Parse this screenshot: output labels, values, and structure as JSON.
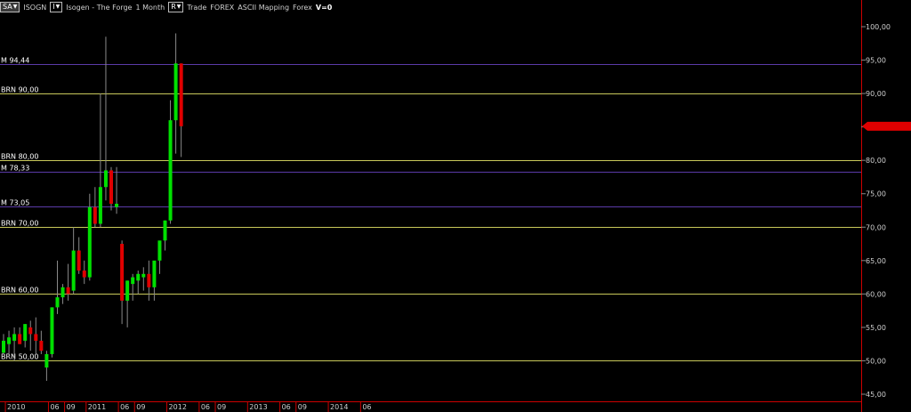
{
  "toolbar": {
    "symbol_box": "SA",
    "symbol": "ISOGN",
    "study_box": "I",
    "title": "Isogen - The Forge",
    "period": "1 Month",
    "r_box": "R",
    "account": "Trade",
    "market": "FOREX",
    "mapping": "ASCII Mapping",
    "market2": "Forex",
    "version": "V=0"
  },
  "colors": {
    "background": "#000000",
    "up_candle": "#00e000",
    "down_candle": "#e00000",
    "brn_line": "#c8c85a",
    "m_line": "#5a3aa8",
    "axis_text": "#cfcfcf",
    "axis_border": "#cc0000",
    "last_price_flag": "#e00000"
  },
  "chart_data": {
    "type": "candlestick",
    "ylim": [
      44,
      102
    ],
    "y_ticks": [
      "45,00",
      "50,00",
      "55,00",
      "60,00",
      "65,00",
      "70,00",
      "75,00",
      "80,00",
      "85,00",
      "90,00",
      "95,00",
      "100,00"
    ],
    "y_tick_values": [
      45,
      50,
      55,
      60,
      65,
      70,
      75,
      80,
      85,
      90,
      95,
      100
    ],
    "x_labels": [
      "2010",
      "06",
      "09",
      "2011",
      "06",
      "09",
      "2012",
      "06",
      "09",
      "2013",
      "06",
      "09",
      "2014",
      "06"
    ],
    "x_label_index": [
      1,
      9,
      12,
      16,
      22,
      25,
      31,
      37,
      40,
      46,
      52,
      55,
      61,
      67
    ],
    "last_price": 85.1,
    "horizontal_levels": [
      {
        "label": "M 94,44",
        "value": 94.44,
        "kind": "m"
      },
      {
        "label": "BRN 90,00",
        "value": 90.0,
        "kind": "brn"
      },
      {
        "label": "BRN 80,00",
        "value": 80.0,
        "kind": "brn"
      },
      {
        "label": "M 78,33",
        "value": 78.33,
        "kind": "m"
      },
      {
        "label": "M 73,05",
        "value": 73.05,
        "kind": "m"
      },
      {
        "label": "BRN 70,00",
        "value": 70.0,
        "kind": "brn"
      },
      {
        "label": "BRN 60,00",
        "value": 60.0,
        "kind": "brn"
      },
      {
        "label": "BRN 50,00",
        "value": 50.0,
        "kind": "brn"
      }
    ],
    "candles": [
      [
        51.2,
        54.0,
        51.0,
        53.0
      ],
      [
        52.5,
        54.5,
        50.5,
        53.5
      ],
      [
        53.0,
        55.0,
        50.0,
        54.0
      ],
      [
        54.0,
        55.0,
        52.5,
        52.5
      ],
      [
        53.0,
        55.5,
        52.0,
        55.5
      ],
      [
        55.0,
        56.0,
        51.5,
        54.0
      ],
      [
        54.0,
        56.5,
        51.0,
        53.0
      ],
      [
        53.0,
        54.5,
        51.0,
        51.5
      ],
      [
        49.0,
        51.5,
        47.0,
        51.0
      ],
      [
        51.0,
        58.0,
        50.5,
        58.0
      ],
      [
        58.0,
        65.0,
        57.0,
        59.5
      ],
      [
        59.5,
        61.5,
        58.5,
        61.0
      ],
      [
        61.0,
        64.5,
        59.0,
        60.0
      ],
      [
        60.5,
        70.0,
        60.0,
        66.5
      ],
      [
        66.5,
        68.5,
        63.0,
        63.5
      ],
      [
        63.5,
        65.0,
        61.5,
        62.5
      ],
      [
        62.5,
        75.0,
        62.0,
        73.0
      ],
      [
        73.0,
        76.0,
        70.0,
        70.5
      ],
      [
        70.5,
        90.0,
        70.0,
        76.0
      ],
      [
        76.0,
        98.5,
        74.0,
        78.5
      ],
      [
        78.5,
        79.0,
        72.5,
        73.5
      ],
      [
        73.0,
        79.0,
        72.0,
        73.5
      ],
      [
        67.5,
        68.0,
        55.5,
        59.0
      ],
      [
        59.0,
        62.0,
        55.0,
        62.0
      ],
      [
        61.5,
        63.0,
        59.0,
        62.5
      ],
      [
        62.0,
        63.5,
        60.0,
        63.0
      ],
      [
        62.5,
        64.0,
        60.5,
        63.0
      ],
      [
        63.0,
        65.0,
        59.0,
        61.0
      ],
      [
        61.0,
        64.5,
        59.0,
        65.0
      ],
      [
        65.0,
        67.0,
        63.0,
        68.0
      ],
      [
        68.0,
        71.0,
        66.5,
        71.0
      ],
      [
        71.0,
        89.0,
        70.5,
        86.0
      ],
      [
        86.0,
        99.0,
        81.0,
        94.5
      ],
      [
        94.5,
        94.5,
        80.5,
        85.1
      ]
    ]
  }
}
